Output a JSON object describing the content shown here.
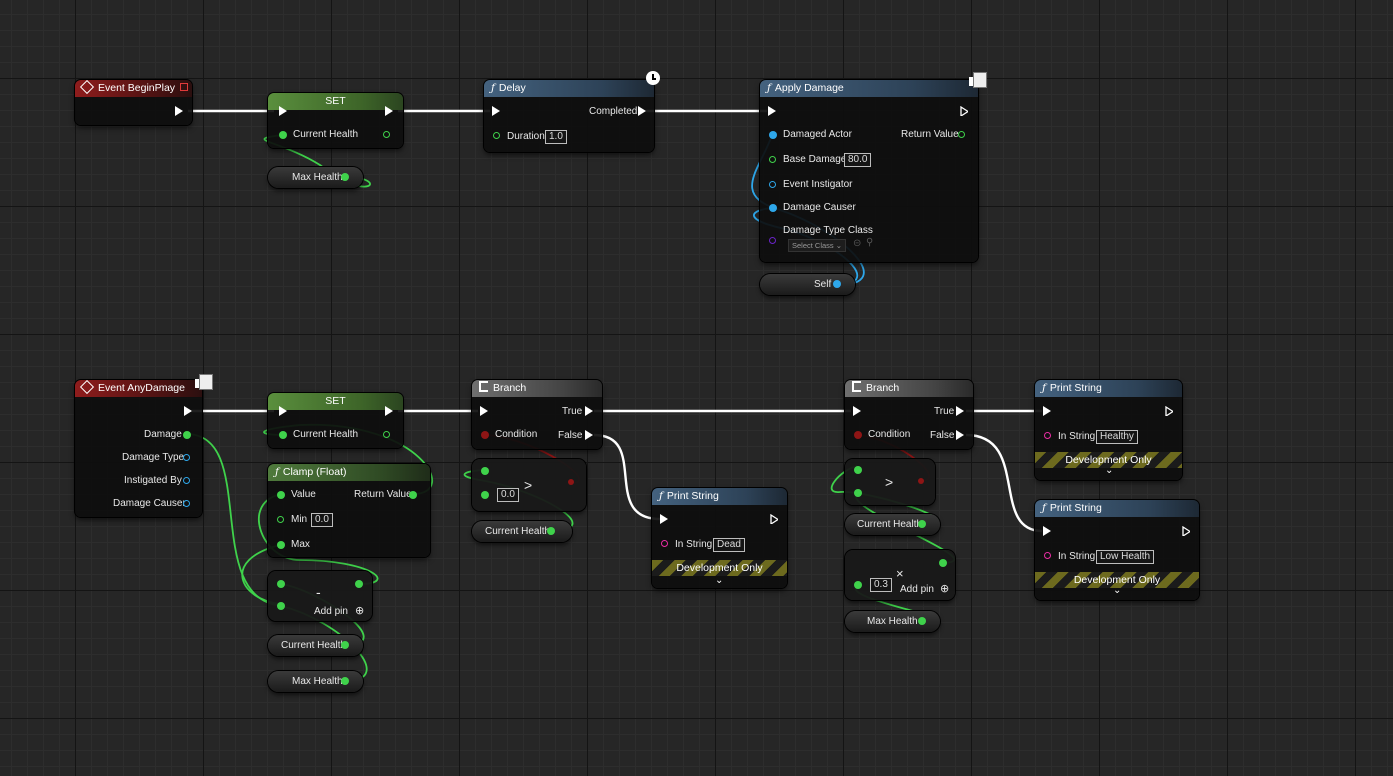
{
  "nodes": {
    "begin_play": {
      "title": "Event BeginPlay"
    },
    "set1": {
      "title": "SET",
      "pin": "Current Health"
    },
    "max_health_get1": {
      "label": "Max Health"
    },
    "delay": {
      "title": "Delay",
      "out_label": "Completed",
      "duration_label": "Duration",
      "duration_value": "1.0"
    },
    "apply_damage": {
      "title": "Apply Damage",
      "pins": [
        "Damaged Actor",
        "Base Damage",
        "Event Instigator",
        "Damage Causer",
        "Damage Type Class"
      ],
      "return_label": "Return Value",
      "base_damage_value": "80.0",
      "select_class": "Select Class"
    },
    "self": {
      "label": "Self"
    },
    "any_damage": {
      "title": "Event AnyDamage",
      "pins": [
        "Damage",
        "Damage Type",
        "Instigated By",
        "Damage Causer"
      ]
    },
    "set2": {
      "title": "SET",
      "pin": "Current Health"
    },
    "clamp": {
      "title": "Clamp (Float)",
      "value_label": "Value",
      "return_label": "Return Value",
      "min_label": "Min",
      "min_value": "0.0",
      "max_label": "Max"
    },
    "subtract": {
      "symbol": "-",
      "add_pin": "Add pin"
    },
    "current_health_get1": {
      "label": "Current Health"
    },
    "max_health_get2": {
      "label": "Max Health"
    },
    "branch1": {
      "title": "Branch",
      "true_label": "True",
      "false_label": "False",
      "condition_label": "Condition"
    },
    "greater1": {
      "symbol": ">",
      "value": "0.0"
    },
    "current_health_get2": {
      "label": "Current Health"
    },
    "print_dead": {
      "title": "Print String",
      "in_string_label": "In String",
      "in_string_value": "Dead",
      "dev_only": "Development Only"
    },
    "branch2": {
      "title": "Branch",
      "true_label": "True",
      "false_label": "False",
      "condition_label": "Condition"
    },
    "greater2": {
      "symbol": ">"
    },
    "current_health_get3": {
      "label": "Current Health"
    },
    "multiply": {
      "symbol": "×",
      "value": "0.3",
      "add_pin": "Add pin"
    },
    "max_health_get3": {
      "label": "Max Health"
    },
    "print_healthy": {
      "title": "Print String",
      "in_string_label": "In String",
      "in_string_value": "Healthy",
      "dev_only": "Development Only"
    },
    "print_low": {
      "title": "Print String",
      "in_string_label": "In String",
      "in_string_value": "Low Health",
      "dev_only": "Development Only"
    }
  },
  "colors": {
    "exec_wire": "#ffffff",
    "float_wire": "#3fd24b",
    "object_wire": "#2ea7ea",
    "bool_wire": "#8e1515"
  }
}
